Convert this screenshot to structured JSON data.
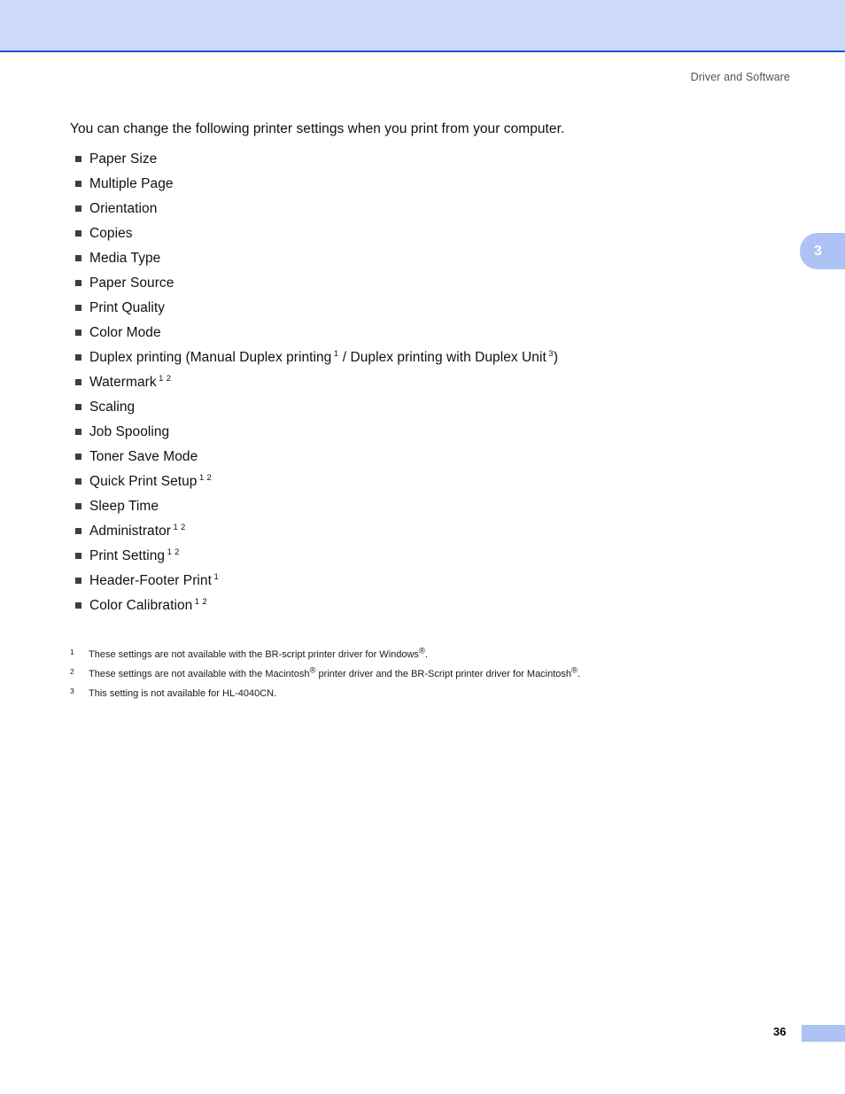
{
  "header": {
    "running_head": "Driver and Software",
    "band_color": "#ccd9f8",
    "rule_color": "#1d52d8"
  },
  "chapter_tab": {
    "number": "3",
    "color": "#adc2f5"
  },
  "main": {
    "intro": "You can change the following printer settings when you print from your computer.",
    "items": [
      {
        "label": "Paper Size",
        "notes": ""
      },
      {
        "label": "Multiple Page",
        "notes": ""
      },
      {
        "label": "Orientation",
        "notes": ""
      },
      {
        "label": "Copies",
        "notes": ""
      },
      {
        "label": "Media Type",
        "notes": ""
      },
      {
        "label": "Paper Source",
        "notes": ""
      },
      {
        "label": "Print Quality",
        "notes": ""
      },
      {
        "label": "Color Mode",
        "notes": ""
      },
      {
        "label": "Duplex printing (Manual Duplex printing",
        "notes": "",
        "complex": true
      },
      {
        "label": "Watermark",
        "notes": "1 2"
      },
      {
        "label": "Scaling",
        "notes": ""
      },
      {
        "label": "Job Spooling",
        "notes": ""
      },
      {
        "label": "Toner Save Mode",
        "notes": ""
      },
      {
        "label": "Quick Print Setup",
        "notes": "1 2"
      },
      {
        "label": "Sleep Time",
        "notes": ""
      },
      {
        "label": "Administrator",
        "notes": "1 2"
      },
      {
        "label": "Print Setting",
        "notes": "1 2"
      },
      {
        "label": "Header-Footer Print",
        "notes": "1"
      },
      {
        "label": "Color Calibration",
        "notes": "1 2"
      }
    ],
    "duplex": {
      "part1": "Duplex printing (Manual Duplex printing",
      "sup1": "1",
      "part2": "/ Duplex printing with Duplex Unit",
      "sup2": "3",
      "part3": ")"
    }
  },
  "footnotes": [
    {
      "number": "1",
      "text_before": "These settings are not available with the BR-script printer driver for Windows",
      "reg1": "®",
      "text_after": "."
    },
    {
      "number": "2",
      "text_before": "These settings are not available with the Macintosh",
      "reg1": "®",
      "text_mid": " printer driver and the BR-Script printer driver for Macintosh",
      "reg2": "®",
      "text_after": "."
    },
    {
      "number": "3",
      "text_before": "This setting is not available for HL-4040CN.",
      "reg1": "",
      "text_after": ""
    }
  ],
  "footer": {
    "page_number": "36",
    "block_color": "#adc2f5"
  }
}
